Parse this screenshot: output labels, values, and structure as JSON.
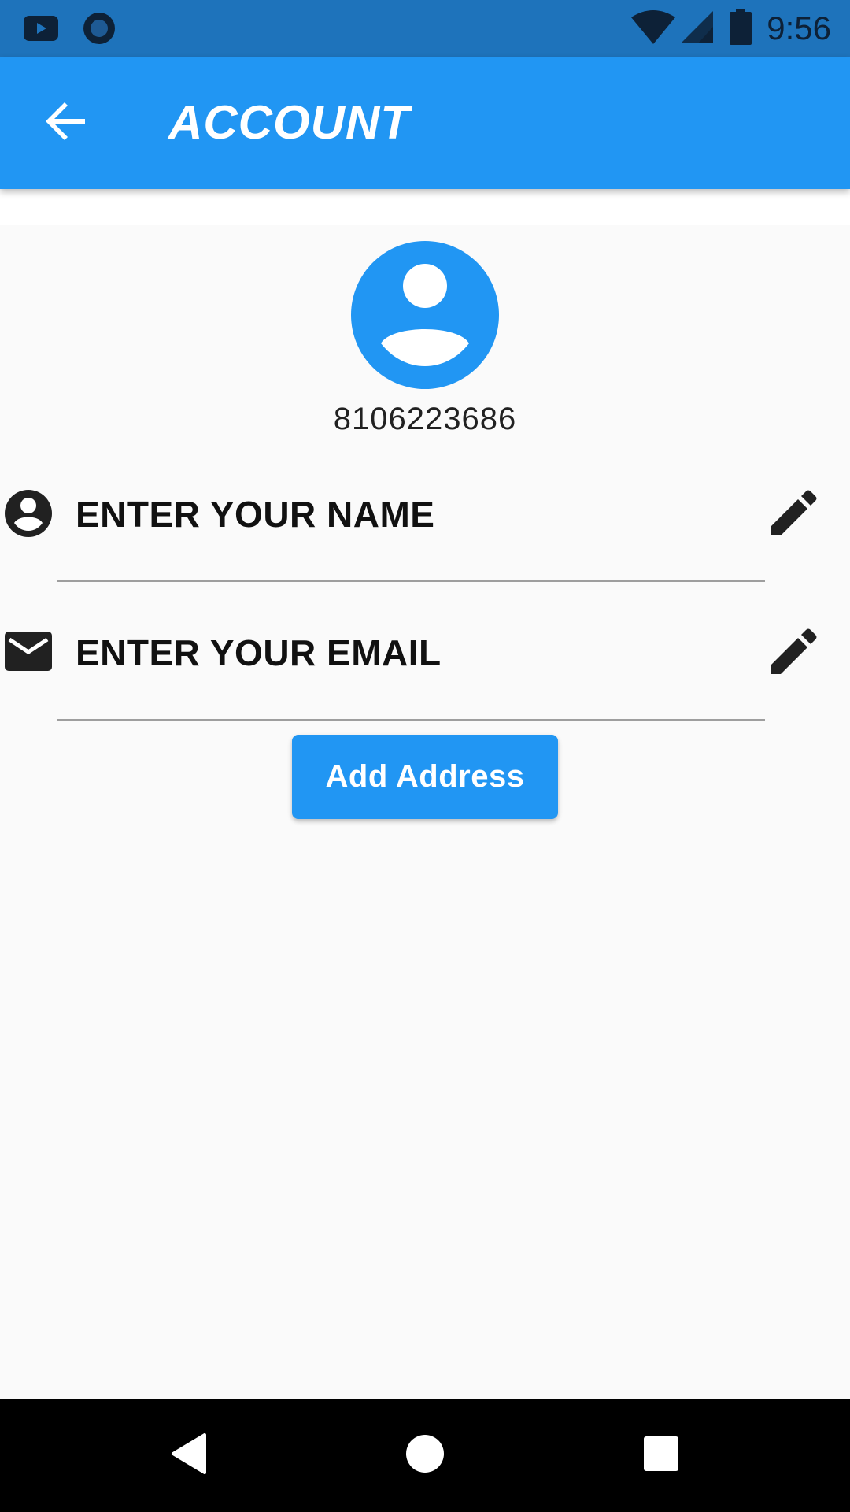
{
  "status_bar": {
    "time": "9:56",
    "left_icons": [
      "youtube-icon",
      "circle-app-icon"
    ],
    "right_icons": [
      "wifi-icon",
      "cell-signal-icon",
      "battery-icon"
    ]
  },
  "app_bar": {
    "title": "ACCOUNT",
    "back_icon": "arrow-back-icon",
    "color": "#2196F3"
  },
  "profile": {
    "avatar_icon": "account-circle-icon",
    "phone": "8106223686"
  },
  "fields": [
    {
      "icon": "person-icon",
      "label": "ENTER YOUR NAME",
      "action_icon": "edit-pencil-icon"
    },
    {
      "icon": "mail-icon",
      "label": "ENTER YOUR EMAIL",
      "action_icon": "edit-pencil-icon"
    }
  ],
  "actions": {
    "add_address_label": "Add Address"
  },
  "nav_bar": {
    "buttons": [
      "back-triangle-icon",
      "home-circle-icon",
      "recents-square-icon"
    ]
  }
}
